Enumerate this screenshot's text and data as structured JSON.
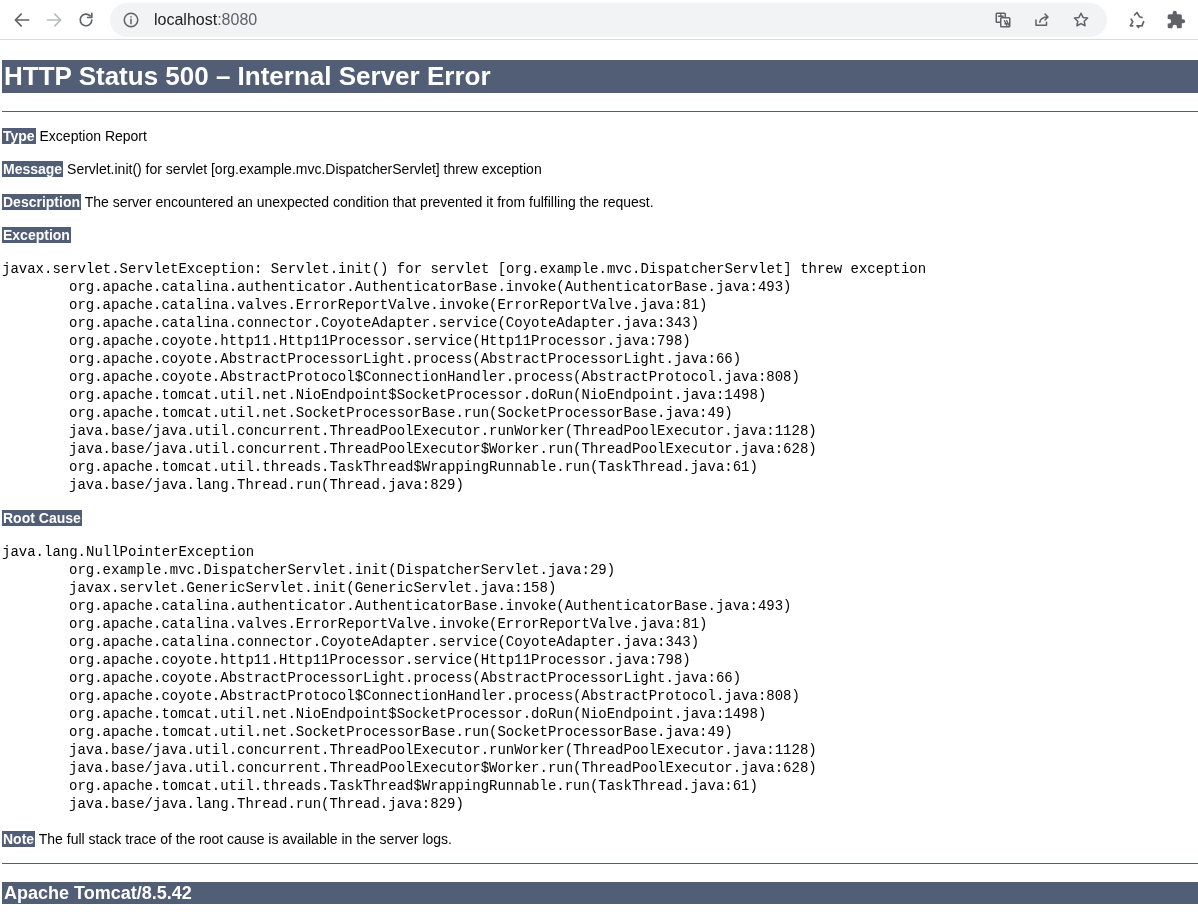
{
  "browser": {
    "url_host": "localhost",
    "url_port": ":8080",
    "back_enabled": true,
    "forward_enabled": false
  },
  "page": {
    "title": "HTTP Status 500 – Internal Server Error",
    "fields": [
      {
        "label": "Type",
        "value": "Exception Report"
      },
      {
        "label": "Message",
        "value": "Servlet.init() for servlet [org.example.mvc.DispatcherServlet] threw exception"
      },
      {
        "label": "Description",
        "value": "The server encountered an unexpected condition that prevented it from fulfilling the request."
      }
    ],
    "traces": [
      {
        "label": "Exception",
        "head": "javax.servlet.ServletException: Servlet.init() for servlet [org.example.mvc.DispatcherServlet] threw exception",
        "frames": [
          "org.apache.catalina.authenticator.AuthenticatorBase.invoke(AuthenticatorBase.java:493)",
          "org.apache.catalina.valves.ErrorReportValve.invoke(ErrorReportValve.java:81)",
          "org.apache.catalina.connector.CoyoteAdapter.service(CoyoteAdapter.java:343)",
          "org.apache.coyote.http11.Http11Processor.service(Http11Processor.java:798)",
          "org.apache.coyote.AbstractProcessorLight.process(AbstractProcessorLight.java:66)",
          "org.apache.coyote.AbstractProtocol$ConnectionHandler.process(AbstractProtocol.java:808)",
          "org.apache.tomcat.util.net.NioEndpoint$SocketProcessor.doRun(NioEndpoint.java:1498)",
          "org.apache.tomcat.util.net.SocketProcessorBase.run(SocketProcessorBase.java:49)",
          "java.base/java.util.concurrent.ThreadPoolExecutor.runWorker(ThreadPoolExecutor.java:1128)",
          "java.base/java.util.concurrent.ThreadPoolExecutor$Worker.run(ThreadPoolExecutor.java:628)",
          "org.apache.tomcat.util.threads.TaskThread$WrappingRunnable.run(TaskThread.java:61)",
          "java.base/java.lang.Thread.run(Thread.java:829)"
        ]
      },
      {
        "label": "Root Cause",
        "head": "java.lang.NullPointerException",
        "frames": [
          "org.example.mvc.DispatcherServlet.init(DispatcherServlet.java:29)",
          "javax.servlet.GenericServlet.init(GenericServlet.java:158)",
          "org.apache.catalina.authenticator.AuthenticatorBase.invoke(AuthenticatorBase.java:493)",
          "org.apache.catalina.valves.ErrorReportValve.invoke(ErrorReportValve.java:81)",
          "org.apache.catalina.connector.CoyoteAdapter.service(CoyoteAdapter.java:343)",
          "org.apache.coyote.http11.Http11Processor.service(Http11Processor.java:798)",
          "org.apache.coyote.AbstractProcessorLight.process(AbstractProcessorLight.java:66)",
          "org.apache.coyote.AbstractProtocol$ConnectionHandler.process(AbstractProtocol.java:808)",
          "org.apache.tomcat.util.net.NioEndpoint$SocketProcessor.doRun(NioEndpoint.java:1498)",
          "org.apache.tomcat.util.net.SocketProcessorBase.run(SocketProcessorBase.java:49)",
          "java.base/java.util.concurrent.ThreadPoolExecutor.runWorker(ThreadPoolExecutor.java:1128)",
          "java.base/java.util.concurrent.ThreadPoolExecutor$Worker.run(ThreadPoolExecutor.java:628)",
          "org.apache.tomcat.util.threads.TaskThread$WrappingRunnable.run(TaskThread.java:61)",
          "java.base/java.lang.Thread.run(Thread.java:829)"
        ]
      }
    ],
    "note": {
      "label": "Note",
      "value": "The full stack trace of the root cause is available in the server logs."
    },
    "footer": "Apache Tomcat/8.5.42"
  }
}
